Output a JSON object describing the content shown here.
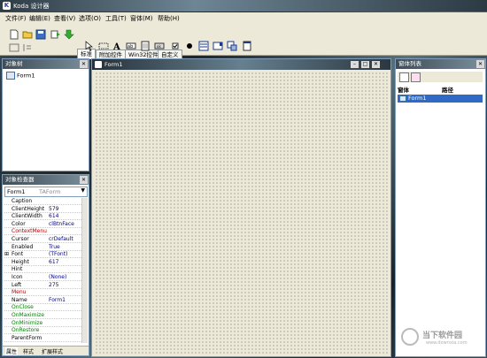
{
  "app": {
    "title": "Koda 设计器"
  },
  "menu": [
    "文件(F)",
    "编辑(E)",
    "查看(V)",
    "选项(O)",
    "工具(T)",
    "窗体(M)",
    "帮助(H)"
  ],
  "palette_tabs": [
    "标准",
    "附加控件",
    "Win32控件",
    "自定义"
  ],
  "tree_panel": {
    "title": "对象树",
    "item": "Form1"
  },
  "inspector": {
    "title": "对象检查器",
    "object": "Form1",
    "object_type": "TAForm",
    "rows": [
      {
        "name": "Caption",
        "value": ""
      },
      {
        "name": "ClientHeight",
        "value": "579"
      },
      {
        "name": "ClientWidth",
        "value": "614"
      },
      {
        "name": "Color",
        "value": "clBtnFace"
      },
      {
        "name": "ContextMenu",
        "value": ""
      },
      {
        "name": "Cursor",
        "value": "crDefault"
      },
      {
        "name": "Enabled",
        "value": "True"
      },
      {
        "name": "Font",
        "value": "(TFont)"
      },
      {
        "name": "Height",
        "value": "617"
      },
      {
        "name": "Hint",
        "value": ""
      },
      {
        "name": "Icon",
        "value": "(None)"
      },
      {
        "name": "Left",
        "value": "275"
      },
      {
        "name": "Menu",
        "value": ""
      },
      {
        "name": "Name",
        "value": "Form1"
      },
      {
        "name": "OnClose",
        "value": ""
      },
      {
        "name": "OnMaximize",
        "value": ""
      },
      {
        "name": "OnMinimize",
        "value": ""
      },
      {
        "name": "OnRestore",
        "value": ""
      },
      {
        "name": "ParentForm",
        "value": ""
      }
    ],
    "tabs": [
      "属性",
      "样式",
      "扩展样式"
    ]
  },
  "form": {
    "title": "Form1"
  },
  "form_list": {
    "title": "窗体列表",
    "col_form": "窗体",
    "col_path": "路径",
    "item": "Form1"
  },
  "watermark": {
    "text": "当下软件园",
    "sub": "www.downxia.com"
  }
}
